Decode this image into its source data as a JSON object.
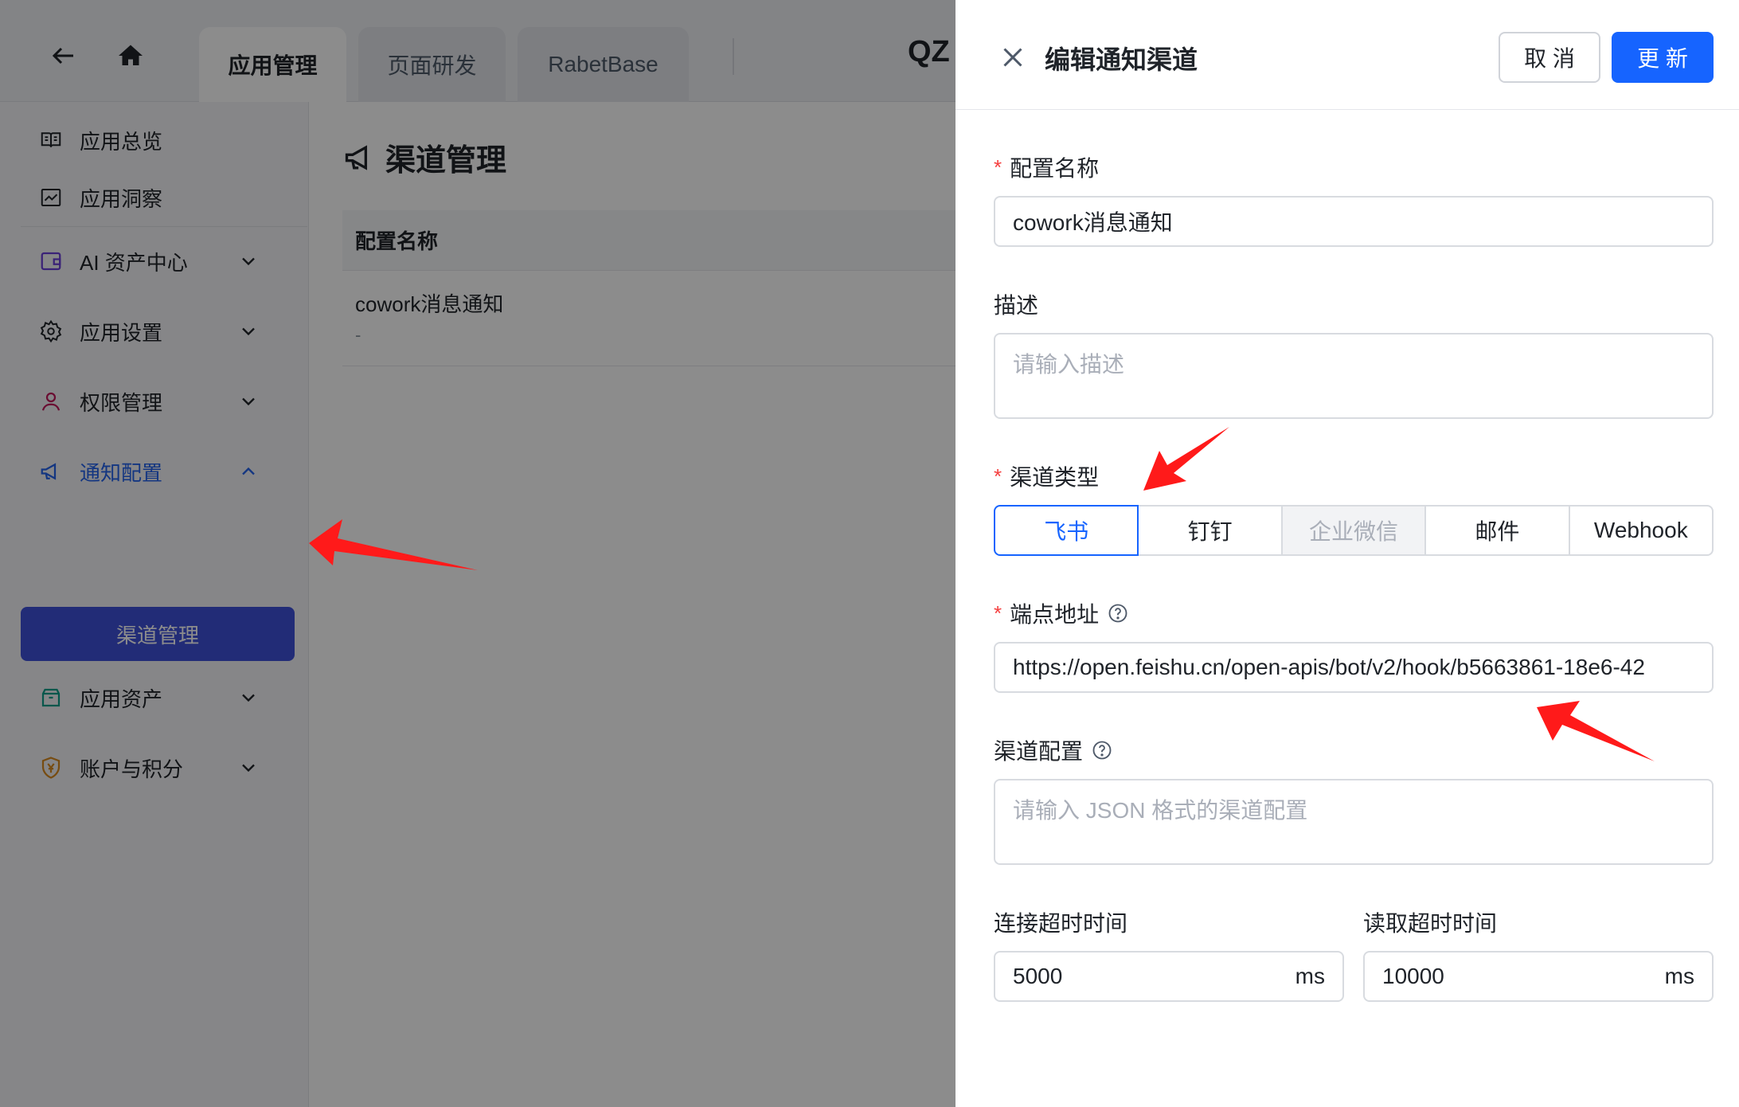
{
  "topbar": {
    "tabs": [
      {
        "label": "应用管理"
      },
      {
        "label": "页面研发"
      },
      {
        "label": "RabetBase"
      }
    ],
    "right_text": "QZ"
  },
  "sidebar": {
    "items": [
      {
        "label": "应用总览",
        "icon": "book-icon"
      },
      {
        "label": "应用洞察",
        "icon": "chart-icon"
      },
      {
        "label": "AI 资产中心",
        "icon": "wallet-icon"
      },
      {
        "label": "应用设置",
        "icon": "gear-icon"
      },
      {
        "label": "权限管理",
        "icon": "user-icon"
      },
      {
        "label": "通知配置",
        "icon": "megaphone-icon"
      },
      {
        "label": "应用资产",
        "icon": "box-icon"
      },
      {
        "label": "账户与积分",
        "icon": "shield-yen-icon"
      }
    ],
    "sub_active": "渠道管理"
  },
  "main": {
    "title": "渠道管理",
    "table_header": "配置名称",
    "row_name": "cowork消息通知",
    "row_desc": "-"
  },
  "drawer": {
    "title": "编辑通知渠道",
    "cancel_label": "取 消",
    "update_label": "更 新",
    "required_mark": "*",
    "name_label": "配置名称",
    "name_value": "cowork消息通知",
    "desc_label": "描述",
    "desc_placeholder": "请输入描述",
    "type_label": "渠道类型",
    "types": [
      "飞书",
      "钉钉",
      "企业微信",
      "邮件",
      "Webhook"
    ],
    "endpoint_label": "端点地址",
    "endpoint_value": "https://open.feishu.cn/open-apis/bot/v2/hook/b5663861-18e6-42",
    "config_label": "渠道配置",
    "config_placeholder": "请输入 JSON 格式的渠道配置",
    "connect_timeout_label": "连接超时时间",
    "connect_timeout_value": "5000",
    "read_timeout_label": "读取超时时间",
    "read_timeout_value": "10000",
    "unit": "ms"
  },
  "colors": {
    "primary": "#1664ff",
    "required": "#f53f3f",
    "sidebar_active": "#3f51d9",
    "annotation_arrow": "#ff1a1a"
  }
}
